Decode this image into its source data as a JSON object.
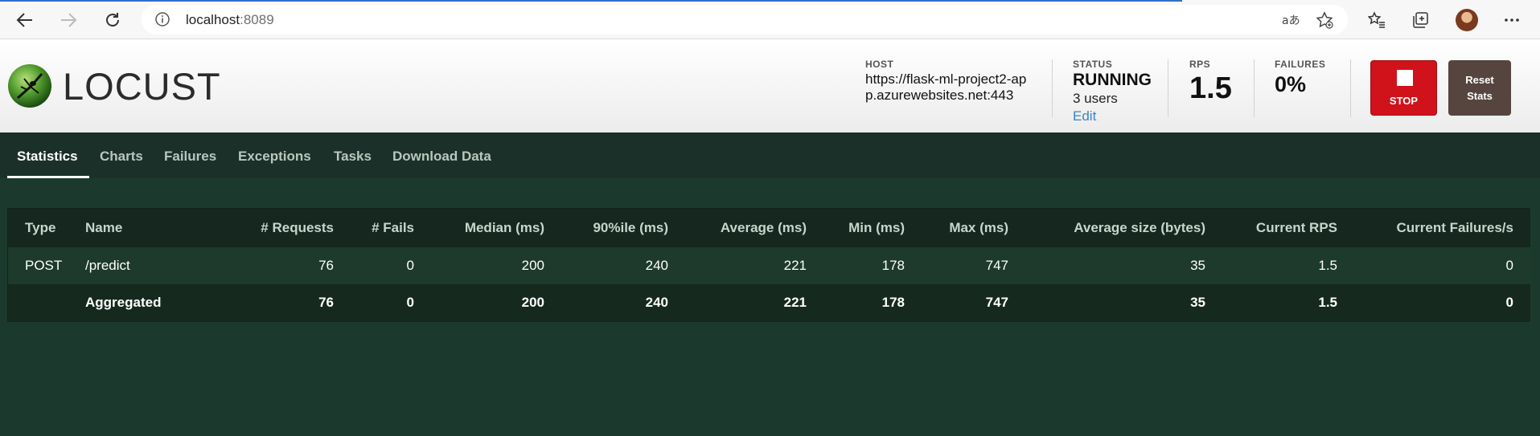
{
  "browser": {
    "url_host": "localhost",
    "url_port": ":8089",
    "icons": [
      "back-arrow-icon",
      "forward-arrow-icon",
      "reload-icon",
      "info-icon",
      "read-aloud-icon",
      "favorite-star-icon",
      "favorites-icon",
      "collections-icon",
      "avatar",
      "more-icon"
    ]
  },
  "header": {
    "logo_text": "LOCUST",
    "host_label": "HOST",
    "host_value": "https://flask-ml-project2-app.azurewebsites.net:443",
    "status_label": "STATUS",
    "status_value": "RUNNING",
    "users_value": "3 users",
    "edit_label": "Edit",
    "rps_label": "RPS",
    "rps_value": "1.5",
    "failures_label": "FAILURES",
    "failures_value": "0%",
    "stop_label": "STOP",
    "reset_label_line1": "Reset",
    "reset_label_line2": "Stats",
    "colors": {
      "stop": "#d0121b",
      "reset": "#56453f"
    }
  },
  "tabs": [
    {
      "label": "Statistics",
      "active": true
    },
    {
      "label": "Charts",
      "active": false
    },
    {
      "label": "Failures",
      "active": false
    },
    {
      "label": "Exceptions",
      "active": false
    },
    {
      "label": "Tasks",
      "active": false
    },
    {
      "label": "Download Data",
      "active": false
    }
  ],
  "stats_table": {
    "columns": [
      "Type",
      "Name",
      "# Requests",
      "# Fails",
      "Median (ms)",
      "90%ile (ms)",
      "Average (ms)",
      "Min (ms)",
      "Max (ms)",
      "Average size (bytes)",
      "Current RPS",
      "Current Failures/s"
    ],
    "rows": [
      [
        "POST",
        "/predict",
        "76",
        "0",
        "200",
        "240",
        "221",
        "178",
        "747",
        "35",
        "1.5",
        "0"
      ]
    ],
    "aggregated": [
      "",
      "Aggregated",
      "76",
      "0",
      "200",
      "240",
      "221",
      "178",
      "747",
      "35",
      "1.5",
      "0"
    ]
  },
  "theme": {
    "background": "#1b3a2d",
    "tab_bar": "#1b3028"
  }
}
